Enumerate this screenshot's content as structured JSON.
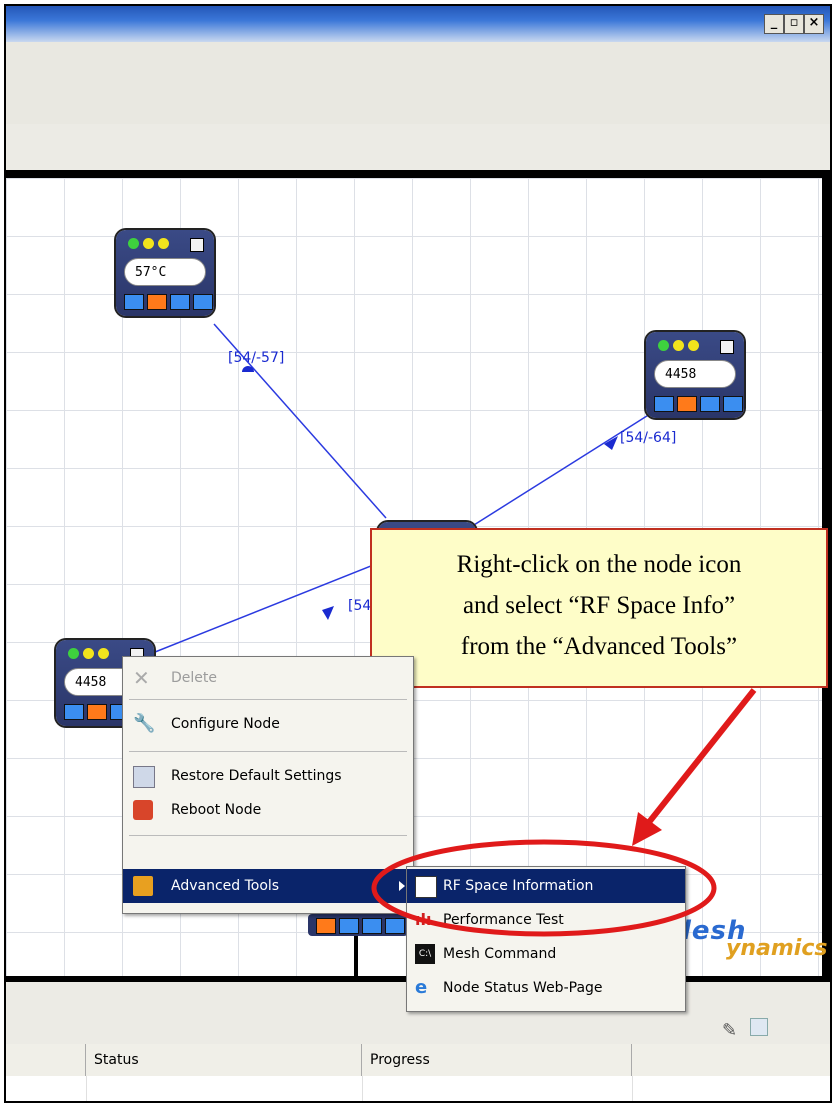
{
  "window": {
    "min_label": "_",
    "max_label": "▫",
    "close_label": "×"
  },
  "nodes": [
    {
      "display": "57°C"
    },
    {
      "display": "4458"
    },
    {
      "display": ""
    },
    {
      "display": "4458"
    }
  ],
  "links": [
    {
      "label": "[54/-57]"
    },
    {
      "label": "[54/-64]"
    },
    {
      "label": "[54"
    }
  ],
  "callout": {
    "line1": "Right-click on the node icon",
    "line2": "and select “RF Space Info”",
    "line3": "from the “Advanced Tools”"
  },
  "context_menu": {
    "items": [
      {
        "label": "Delete",
        "icon": "delete-icon",
        "enabled": false
      },
      {
        "label": "Configure Node",
        "icon": "wrench-icon"
      },
      {
        "label": "Restore Default Settings",
        "icon": "restore-icon"
      },
      {
        "label": "Reboot Node",
        "icon": "reboot-icon"
      },
      {
        "label": "Advanced Tools",
        "icon": "tools-icon",
        "highlighted": true
      }
    ]
  },
  "submenu": {
    "items": [
      {
        "label": "RF Space Information",
        "icon": "chart-icon",
        "highlighted": true
      },
      {
        "label": "Performance Test",
        "icon": "performance-icon"
      },
      {
        "label": "Mesh Command",
        "icon": "command-icon"
      },
      {
        "label": "Node Status Web-Page",
        "icon": "browser-icon"
      }
    ]
  },
  "brand": {
    "part1": "Mesh",
    "part2": "Dynamics",
    "shown1": "lesh",
    "shown2": "ynamics"
  },
  "table": {
    "columns": [
      "Status",
      "Progress"
    ]
  },
  "colors": {
    "accent": "#0a246a",
    "link": "#1a2ad0",
    "highlight_ring": "#e01a1a"
  }
}
